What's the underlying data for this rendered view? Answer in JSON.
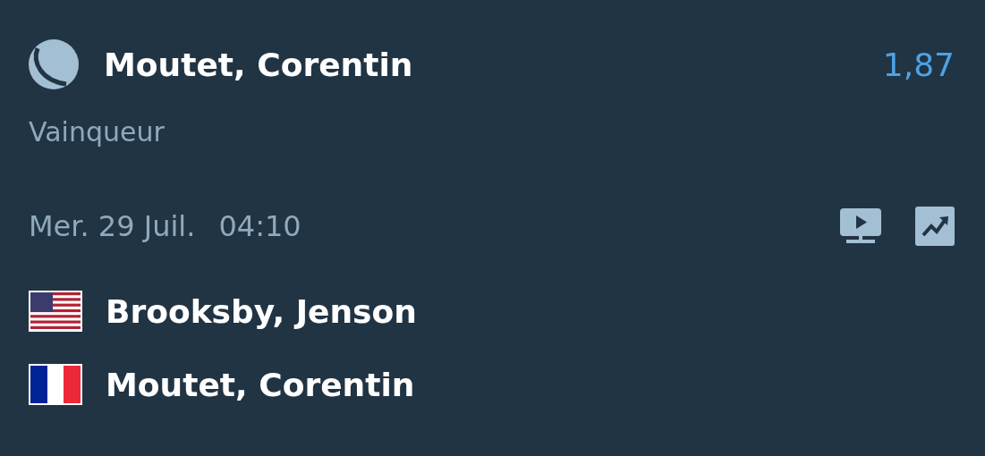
{
  "selection": {
    "name": "Moutet, Corentin",
    "odds": "1,87",
    "market": "Vainqueur"
  },
  "match": {
    "date": "Mer. 29 Juil.",
    "time": "04:10"
  },
  "players": [
    {
      "name": "Brooksby, Jenson",
      "kind": "us"
    },
    {
      "name": "Moutet, Corentin",
      "kind": "fr"
    }
  ]
}
